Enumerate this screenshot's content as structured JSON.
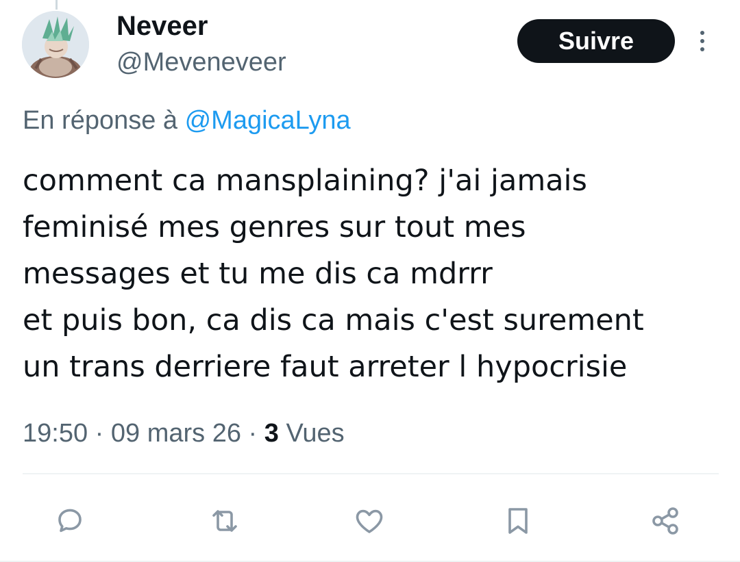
{
  "author": {
    "display_name": "Neveer",
    "handle": "@Meveneveer"
  },
  "header": {
    "follow_label": "Suivre",
    "more_icon": "more-vertical-icon"
  },
  "reply": {
    "prefix": "En réponse à ",
    "mention": "@MagicaLyna"
  },
  "tweet": {
    "text": "comment ca mansplaining? j'ai jamais\nfeminisé mes genres sur tout mes\nmessages et tu me dis ca mdrrr\net puis bon, ca dis ca mais c'est surement\nun trans derriere faut arreter l hypocrisie"
  },
  "meta": {
    "time": "19:50",
    "separator1": " · ",
    "date": "09 mars 26",
    "separator2": " · ",
    "views_count": "3",
    "views_label": " Vues"
  },
  "actions": [
    {
      "name": "reply",
      "icon": "comment-icon"
    },
    {
      "name": "repost",
      "icon": "repost-icon"
    },
    {
      "name": "like",
      "icon": "heart-icon"
    },
    {
      "name": "bookmark",
      "icon": "bookmark-icon"
    },
    {
      "name": "share",
      "icon": "share-icon"
    }
  ],
  "colors": {
    "text_primary": "#0f1419",
    "text_secondary": "#536471",
    "accent": "#1d9bf0",
    "icon": "#8b98a5",
    "divider": "#eff3f4"
  }
}
